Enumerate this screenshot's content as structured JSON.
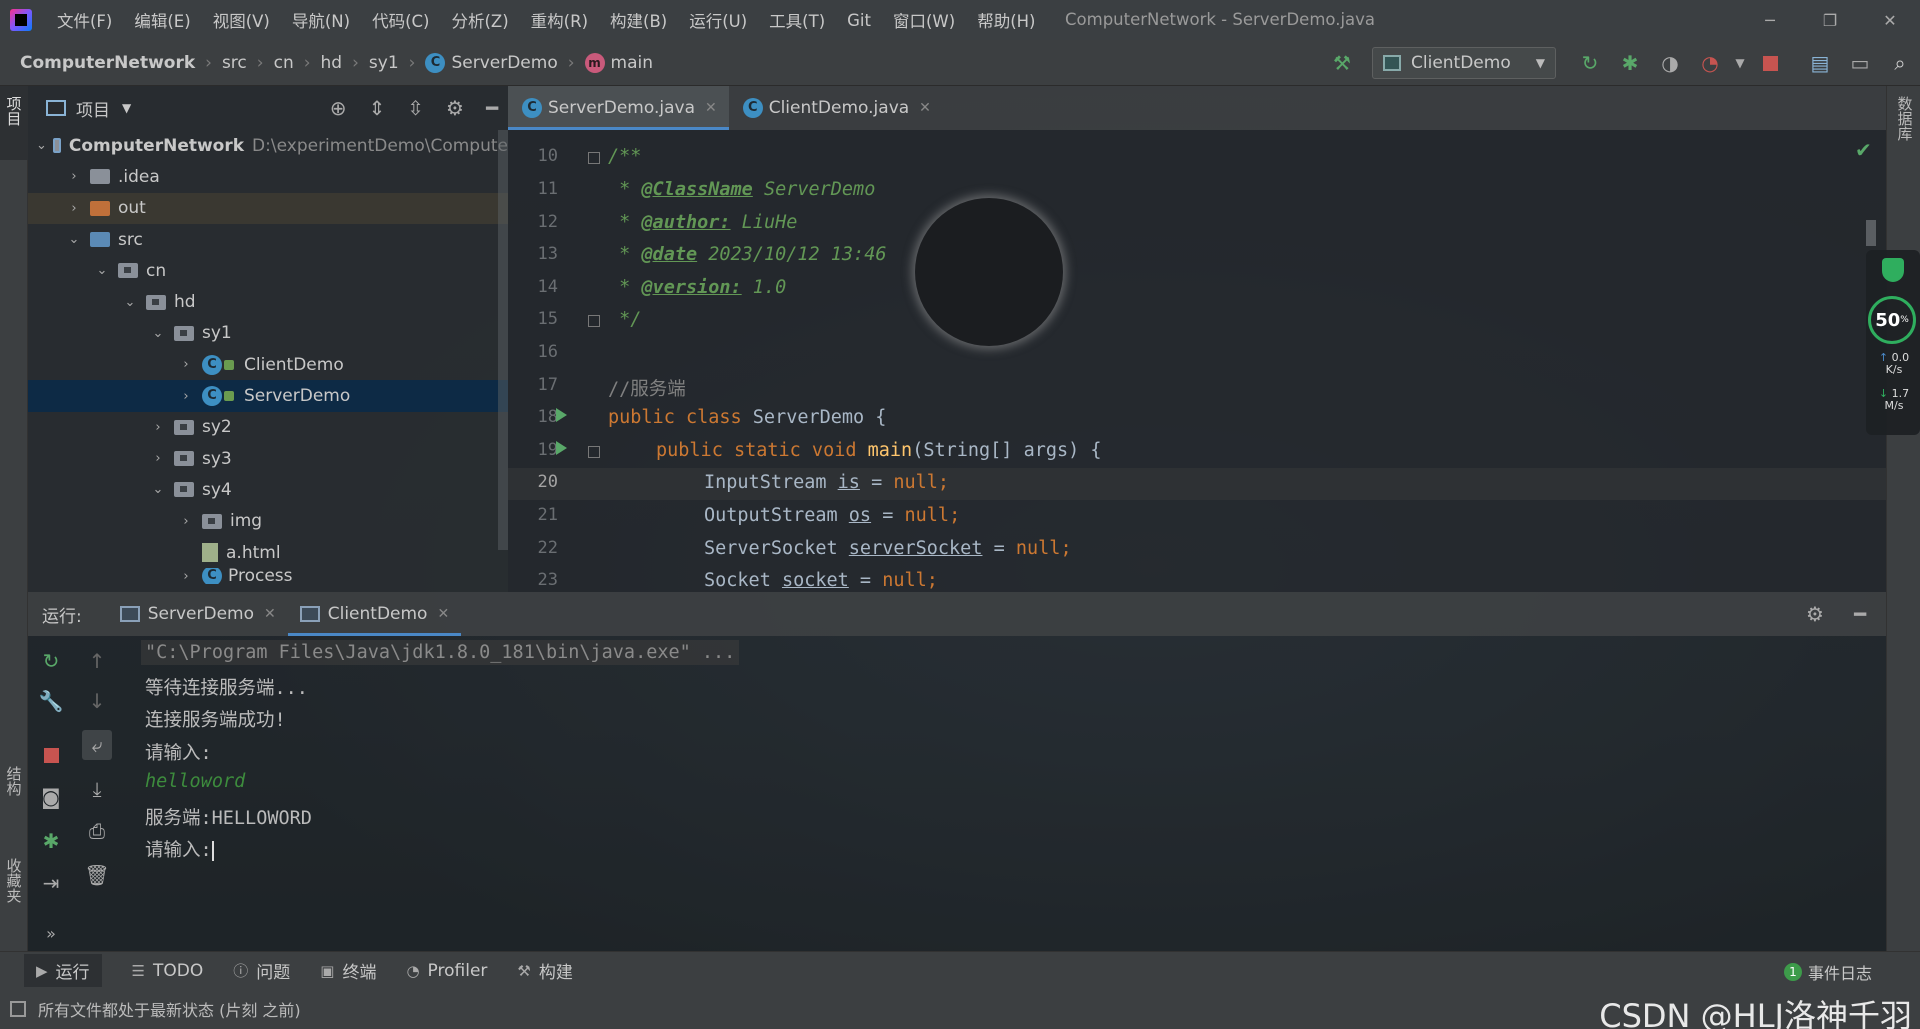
{
  "menubar": {
    "items": [
      "文件(F)",
      "编辑(E)",
      "视图(V)",
      "导航(N)",
      "代码(C)",
      "分析(Z)",
      "重构(R)",
      "构建(B)",
      "运行(U)",
      "工具(T)",
      "Git",
      "窗口(W)",
      "帮助(H)"
    ],
    "title": "ComputerNetwork - ServerDemo.java"
  },
  "navbar": {
    "crumbs": [
      "ComputerNetwork",
      "src",
      "cn",
      "hd",
      "sy1",
      "ServerDemo",
      "main"
    ],
    "run_config": "ClientDemo"
  },
  "left_strip": {
    "project": "项目",
    "structure": "结构",
    "favorites": "收藏夹"
  },
  "right_strip": {
    "database": "数据库"
  },
  "project": {
    "header": "项目",
    "tree": [
      {
        "label": "ComputerNetwork",
        "path": "D:\\experimentDemo\\Compute"
      },
      {
        "label": ".idea"
      },
      {
        "label": "out"
      },
      {
        "label": "src"
      },
      {
        "label": "cn"
      },
      {
        "label": "hd"
      },
      {
        "label": "sy1"
      },
      {
        "label": "ClientDemo"
      },
      {
        "label": "ServerDemo"
      },
      {
        "label": "sy2"
      },
      {
        "label": "sy3"
      },
      {
        "label": "sy4"
      },
      {
        "label": "img"
      },
      {
        "label": "a.html"
      },
      {
        "label": "Process"
      }
    ]
  },
  "editor": {
    "tabs": [
      {
        "label": "ServerDemo.java",
        "active": true
      },
      {
        "label": "ClientDemo.java",
        "active": false
      }
    ],
    "line_numbers": [
      "10",
      "11",
      "12",
      "13",
      "14",
      "15",
      "16",
      "17",
      "18",
      "19",
      "20",
      "21",
      "22",
      "23"
    ],
    "current_line": "20",
    "code": {
      "l10": "/**",
      "l11_star": " * ",
      "l11_tag": "@ClassName",
      "l11_val": " ServerDemo",
      "l12_tag": "@author:",
      "l12_val": " LiuHe",
      "l13_tag": "@date",
      "l13_val": " 2023/10/12 13:46",
      "l14_tag": "@version:",
      "l14_val": " 1.0",
      "l15": " */",
      "l17": "//服务端",
      "l18_kw": "public class",
      "l18_rest": " ServerDemo {",
      "l19_kw": "public static void",
      "l19_fn": "main",
      "l19_rest": "(String[] args) {",
      "l20_type": "InputStream ",
      "l20_var": "is",
      "l20_eq": " = ",
      "l20_null": "null",
      "l21_type": "OutputStream ",
      "l21_var": "os",
      "l22_type": "ServerSocket ",
      "l22_var": "serverSocket",
      "l23_type": "Socket ",
      "l23_var": "socket",
      "semi": ";"
    }
  },
  "net_widget": {
    "percent": "50",
    "percent_unit": "%",
    "up_value": "0.0",
    "up_unit": "K/s",
    "down_value": "1.7",
    "down_unit": "M/s"
  },
  "run": {
    "label": "运行:",
    "tabs": [
      {
        "label": "ServerDemo",
        "active": false
      },
      {
        "label": "ClientDemo",
        "active": true
      }
    ],
    "console": [
      "\"C:\\Program Files\\Java\\jdk1.8.0_181\\bin\\java.exe\" ...",
      "等待连接服务端...",
      "连接服务端成功!",
      "请输入:",
      "helloword",
      "服务端:HELLOWORD",
      "请输入:"
    ]
  },
  "bottombar": {
    "tabs": [
      "运行",
      "TODO",
      "问题",
      "终端",
      "Profiler",
      "构建"
    ],
    "event_log": "事件日志",
    "event_count": "1"
  },
  "statusbar": {
    "message": "所有文件都处于最新状态 (片刻 之前)",
    "watermark": "CSDN @HLJ洛神千羽"
  },
  "colors": {
    "keyword": "#cc7832",
    "comment_doc": "#629755",
    "function": "#ffc66d",
    "selection": "#0d2a45",
    "accent": "#4a88c7",
    "run_green": "#59a869",
    "stop_red": "#c75450"
  }
}
